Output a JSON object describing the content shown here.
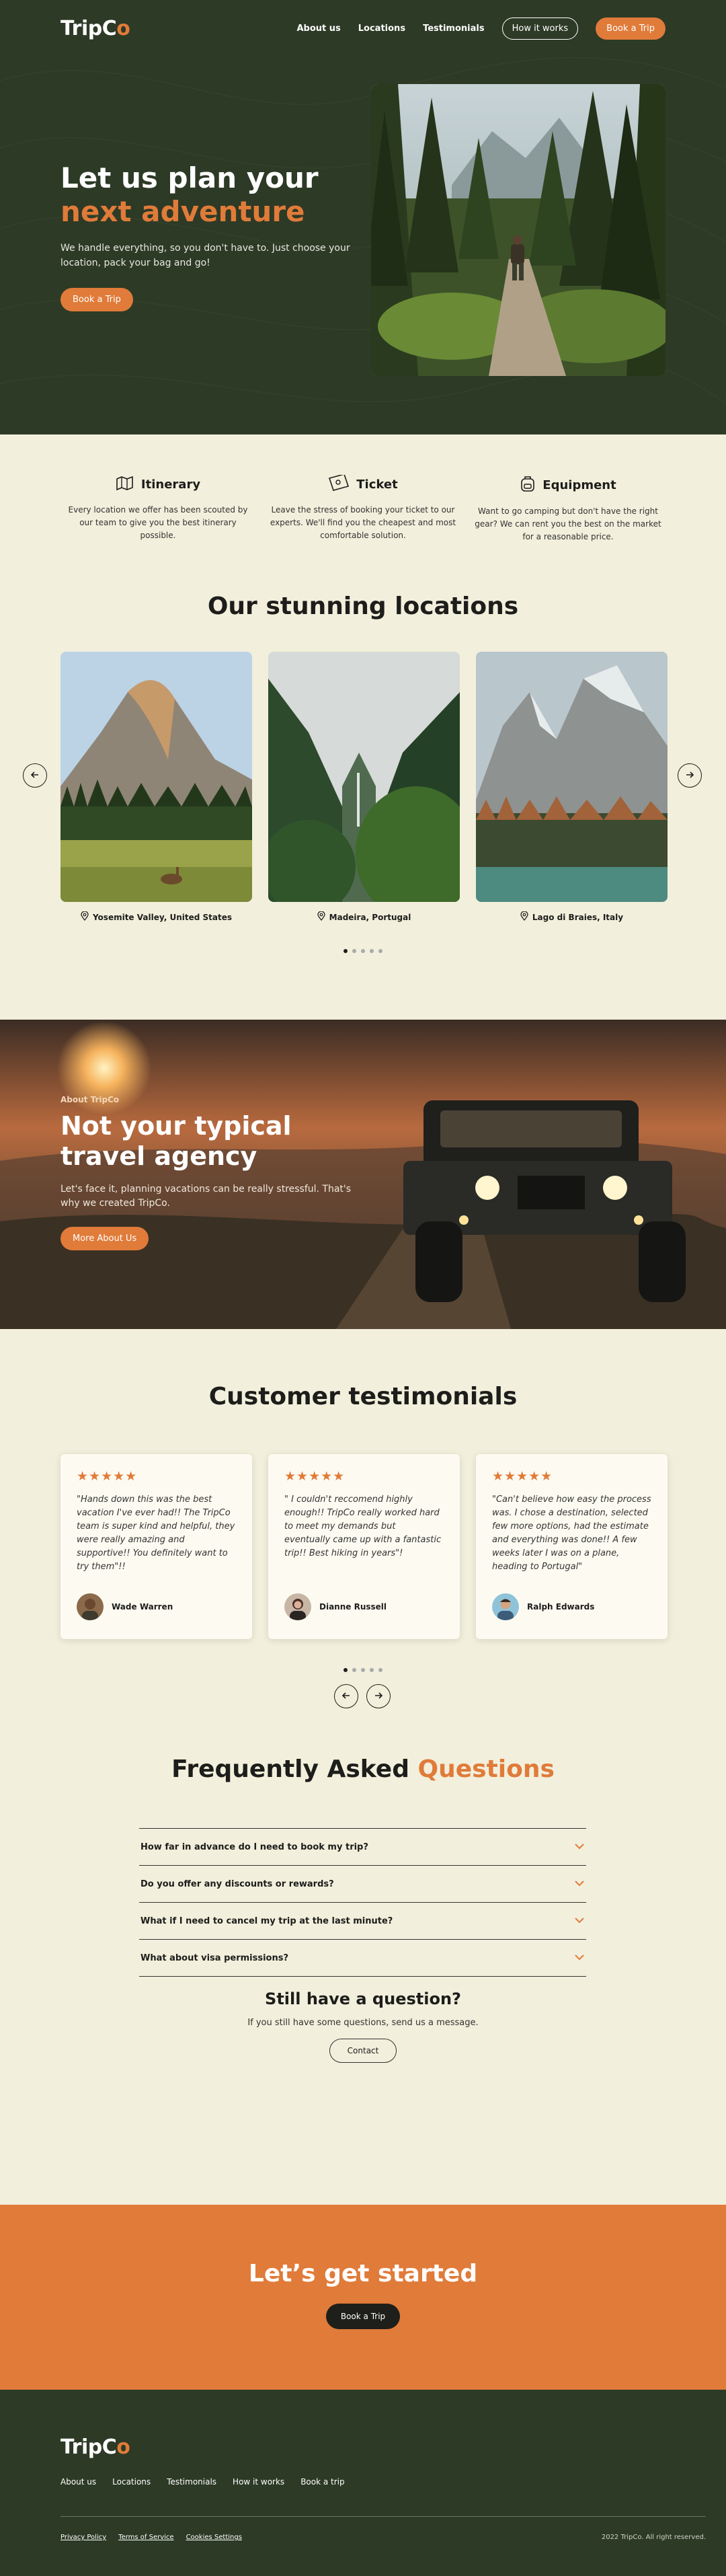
{
  "nav": {
    "logo_text": "TripC",
    "logo_accent": "o",
    "links": [
      "About us",
      "Locations",
      "Testimonials"
    ],
    "how_it_works": "How it works",
    "book_trip": "Book a Trip"
  },
  "hero": {
    "title_plain": "Let us plan your",
    "title_accent": "next adventure",
    "subtitle": "We handle everything, so you don't have to. Just choose your location, pack your bag and go!",
    "cta": "Book a Trip"
  },
  "features": [
    {
      "icon": "map-icon",
      "title": "Itinerary",
      "text": "Every location we offer has been scouted by our team to give you the best itinerary possible."
    },
    {
      "icon": "ticket-icon",
      "title": "Ticket",
      "text": "Leave the stress of booking your ticket to our experts. We'll find you the cheapest and most comfortable solution."
    },
    {
      "icon": "backpack-icon",
      "title": "Equipment",
      "text": "Want to go camping but don't have the right gear? We can rent you the best on the market for a reasonable price."
    }
  ],
  "locations": {
    "title": "Our stunning locations",
    "items": [
      {
        "label": "Yosemite Valley, United States"
      },
      {
        "label": "Madeira, Portugal"
      },
      {
        "label": "Lago di Braies, Italy"
      }
    ],
    "dots_total": 5,
    "dots_active": 1
  },
  "about": {
    "kicker": "About TripCo",
    "title": "Not your typical travel agency",
    "text": "Let's face it, planning vacations can be really stressful. That's why we created TripCo.",
    "cta": "More About Us"
  },
  "testimonials": {
    "title": "Customer testimonials",
    "stars": "★★★★★",
    "items": [
      {
        "quote": "\"Hands down this was the best vacation I've ever had!! The TripCo team is super kind and helpful, they were really amazing and supportive!! You definitely want to try them\"!!",
        "author": "Wade Warren"
      },
      {
        "quote": "\" I couldn't reccomend highly enough!! TripCo really worked hard to meet my demands but eventually came up with a fantastic trip!! Best hiking in years\"!",
        "author": "Dianne Russell"
      },
      {
        "quote": "\"Can't believe how easy the process was. I chose a destination, selected few more options, had the estimate and everything was done!! A  few weeks later I was on a plane, heading to Portugal\"",
        "author": "Ralph Edwards"
      }
    ],
    "dots_total": 5,
    "dots_active": 1
  },
  "faq": {
    "title_plain": "Frequently Asked",
    "title_accent": "Questions",
    "items": [
      "How far in advance do I need to book my trip?",
      "Do you offer any discounts or rewards?",
      "What if I need to cancel my trip at the last minute?",
      "What about visa permissions?"
    ],
    "still_title": "Still have a question?",
    "still_text": "If you still have some questions, send us a message.",
    "contact": "Contact"
  },
  "cta": {
    "title": "Let’s get started",
    "button": "Book a Trip"
  },
  "footer": {
    "logo_text": "TripC",
    "logo_accent": "o",
    "links": [
      "About us",
      "Locations",
      "Testimonials",
      "How it works",
      "Book a trip"
    ],
    "legal": [
      "Privacy Policy",
      "Terms of Service",
      "Cookies Settings"
    ],
    "copyright": "2022 TripCo. All right reserved."
  },
  "colors": {
    "dark_green": "#2d3a26",
    "cream": "#f2efdc",
    "accent_orange": "#e07b39",
    "card_bg": "#fdfbf1"
  }
}
